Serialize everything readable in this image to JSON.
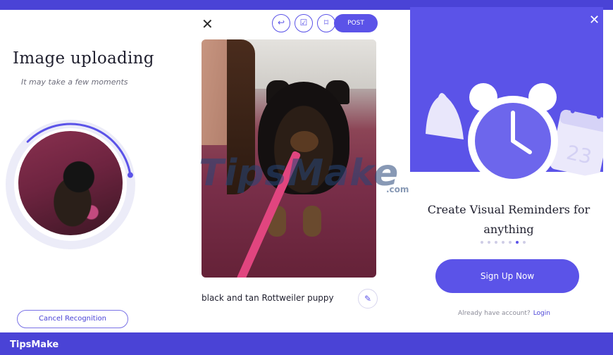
{
  "upload": {
    "title": "Image uploading",
    "subtitle": "It may take a few moments",
    "progress_fraction": 0.35,
    "cancel_label": "Cancel Recognition"
  },
  "editor": {
    "close_icon": "close-icon",
    "share_icon": "share-icon",
    "check_icon": "checklist-icon",
    "bookmark_icon": "bookmark-icon",
    "post_label": "POST",
    "caption": "black and tan Rottweiler puppy",
    "edit_icon": "pencil-icon"
  },
  "watermark": {
    "text": "TipsMake",
    "suffix": ".com"
  },
  "onboarding": {
    "close_icon": "close-icon",
    "title": "Create Visual Reminders for anything",
    "page_count": 7,
    "active_page": 6,
    "signup_label": "Sign Up Now",
    "account_prompt": "Already have account?",
    "login_label": "Login",
    "calendar_number": "23",
    "accent_color": "#5b53e8"
  },
  "footer": {
    "brand": "TipsMake",
    "bar_color": "#4a43d6"
  }
}
